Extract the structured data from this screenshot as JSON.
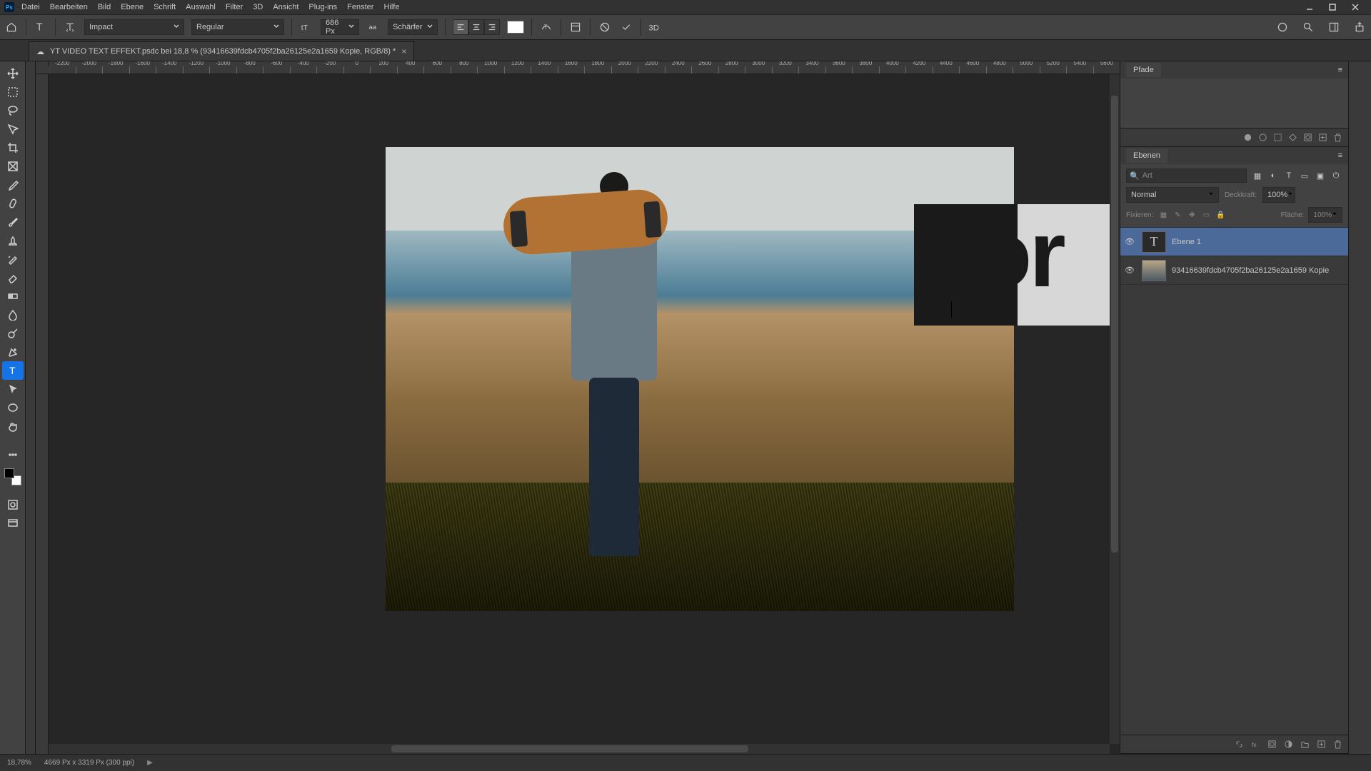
{
  "menubar": [
    "Datei",
    "Bearbeiten",
    "Bild",
    "Ebene",
    "Schrift",
    "Auswahl",
    "Filter",
    "3D",
    "Ansicht",
    "Plug-ins",
    "Fenster",
    "Hilfe"
  ],
  "options": {
    "font_family": "Impact",
    "font_style": "Regular",
    "font_size": "686 Px",
    "antialias": "Schärfer",
    "color": "#ffffff"
  },
  "document": {
    "tab_title": "YT VIDEO TEXT EFFEKT.psdc bei 18,8 % (93416639fdcb4705f2ba26125e2a1659 Kopie, RGB/8) *",
    "text_content": "Lor"
  },
  "ruler_ticks": [
    "-2200",
    "-2000",
    "-1800",
    "-1600",
    "-1400",
    "-1200",
    "-1000",
    "-800",
    "-600",
    "-400",
    "-200",
    "0",
    "200",
    "400",
    "600",
    "800",
    "1000",
    "1200",
    "1400",
    "1600",
    "1800",
    "2000",
    "2200",
    "2400",
    "2600",
    "2800",
    "3000",
    "3200",
    "3400",
    "3600",
    "3800",
    "4000",
    "4200",
    "4400",
    "4600",
    "4800",
    "5000",
    "5200",
    "5400",
    "5600"
  ],
  "panels": {
    "paths_title": "Pfade",
    "layers_title": "Ebenen",
    "search_placeholder": "Art",
    "blend_mode": "Normal",
    "opacity_label": "Deckkraft:",
    "opacity_value": "100%",
    "lock_label": "Fixieren:",
    "fill_label": "Fläche:",
    "fill_value": "100%",
    "layers": [
      {
        "name": "Ebene 1",
        "type": "text",
        "visible": true,
        "selected": true
      },
      {
        "name": "93416639fdcb4705f2ba26125e2a1659  Kopie",
        "type": "image",
        "visible": true,
        "selected": false
      }
    ]
  },
  "status": {
    "zoom": "18,78%",
    "dims": "4669 Px x 3319 Px (300 ppi)"
  }
}
